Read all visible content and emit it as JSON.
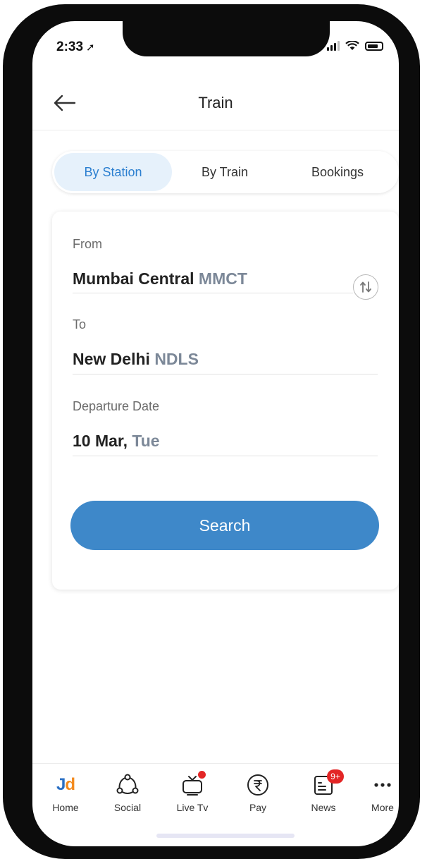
{
  "status": {
    "time": "2:33",
    "location_glyph": "➚"
  },
  "header": {
    "title": "Train"
  },
  "tabs": [
    {
      "label": "By Station",
      "active": true
    },
    {
      "label": "By Train",
      "active": false
    },
    {
      "label": "Bookings",
      "active": false
    }
  ],
  "form": {
    "from": {
      "label": "From",
      "city": "Mumbai Central",
      "code": "MMCT"
    },
    "to": {
      "label": "To",
      "city": "New Delhi",
      "code": "NDLS"
    },
    "date": {
      "label": "Departure Date",
      "day": "10 Mar,",
      "weekday": "Tue"
    },
    "search_label": "Search"
  },
  "bottom_nav": [
    {
      "label": "Home",
      "icon": "jd-logo-icon"
    },
    {
      "label": "Social",
      "icon": "social-icon"
    },
    {
      "label": "Live Tv",
      "icon": "tv-icon",
      "dot": true
    },
    {
      "label": "Pay",
      "icon": "rupee-icon"
    },
    {
      "label": "News",
      "icon": "news-icon",
      "badge": "9+"
    },
    {
      "label": "More",
      "icon": "more-icon"
    }
  ],
  "logo": {
    "j": "J",
    "d": "d"
  },
  "colors": {
    "accent": "#3e88c9",
    "active_tab_bg": "#e6f1fb",
    "active_tab_text": "#2b7fd0",
    "badge": "#e32626"
  }
}
